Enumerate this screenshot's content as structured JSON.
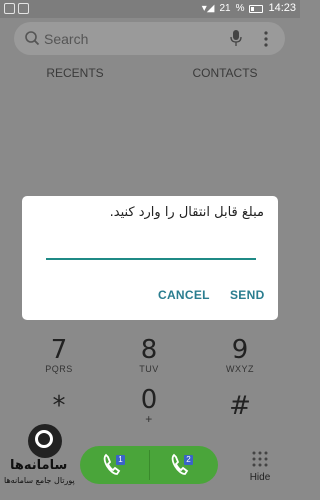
{
  "status_bar": {
    "network": "21",
    "signal": "▾◢",
    "battery": "%",
    "time": "14:23"
  },
  "search": {
    "placeholder": "Search"
  },
  "tabs": [
    {
      "label": "RECENTS"
    },
    {
      "label": "CONTACTS"
    }
  ],
  "dialog": {
    "message": "مبلغ قابل انتقال را وارد کنید.",
    "cancel_label": "CANCEL",
    "send_label": "SEND"
  },
  "keypad": [
    {
      "digit": "7",
      "letters": "PQRS"
    },
    {
      "digit": "8",
      "letters": "TUV"
    },
    {
      "digit": "9",
      "letters": "WXYZ"
    },
    {
      "digit": "*",
      "letters": ""
    },
    {
      "digit": "0",
      "letters": "+"
    },
    {
      "digit": "#",
      "letters": ""
    }
  ],
  "call": {
    "sim1": "1",
    "sim2": "2"
  },
  "hide_label": "Hide",
  "watermark": {
    "title": "سامانه‌ها",
    "subtitle": "پورتال جامع سامانه‌ها"
  },
  "colors": {
    "accent": "#2a7d8f",
    "call_green": "#4aa53a",
    "input_line": "#1f8a86"
  }
}
